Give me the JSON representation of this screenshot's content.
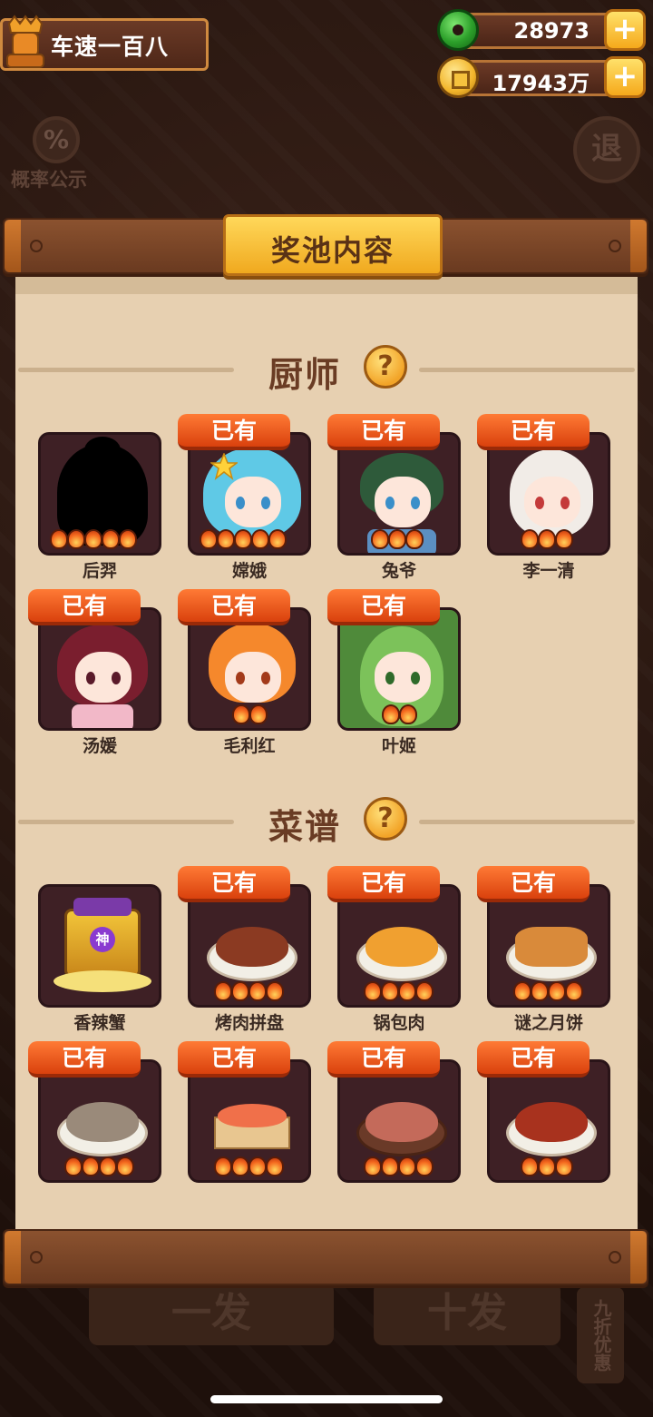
{
  "player": {
    "name": "车速一百八"
  },
  "currency": {
    "jade": "28973",
    "gold": "17943万",
    "plus_label": "+"
  },
  "side": {
    "probability_icon": "%",
    "probability_label": "概率公示",
    "back_label": "退"
  },
  "modal": {
    "title": "奖池内容",
    "chef_section": "厨师",
    "recipe_section": "菜谱",
    "help_label": "?",
    "owned_label": "已有"
  },
  "chefs": [
    {
      "name": "后羿",
      "owned": false,
      "flames": 5
    },
    {
      "name": "嫦娥",
      "owned": true,
      "flames": 5
    },
    {
      "name": "兔爷",
      "owned": true,
      "flames": 3
    },
    {
      "name": "李一清",
      "owned": true,
      "flames": 3
    },
    {
      "name": "汤媛",
      "owned": true,
      "flames": 0
    },
    {
      "name": "毛利红",
      "owned": true,
      "flames": 2
    },
    {
      "name": "叶姬",
      "owned": true,
      "flames": 2
    }
  ],
  "recipes": [
    {
      "name": "香辣蟹",
      "owned": false,
      "flames": 0,
      "badge": "神"
    },
    {
      "name": "烤肉拼盘",
      "owned": true,
      "flames": 4
    },
    {
      "name": "锅包肉",
      "owned": true,
      "flames": 4
    },
    {
      "name": "谜之月饼",
      "owned": true,
      "flames": 4
    },
    {
      "name": "",
      "owned": true,
      "flames": 4
    },
    {
      "name": "",
      "owned": true,
      "flames": 4
    },
    {
      "name": "",
      "owned": true,
      "flames": 4
    },
    {
      "name": "",
      "owned": true,
      "flames": 3
    }
  ],
  "bottom": {
    "single_draw": "一发",
    "ten_draw": "十发",
    "discount": "九折优惠"
  },
  "colors": {
    "owned_badge": "#e2521a",
    "card_bg": "#3e2025",
    "panel_bg": "#e7d0b1",
    "title_tab": "#f7c03a"
  },
  "icons": {
    "jade": "jade-icon",
    "gold": "coin-icon",
    "help": "question-icon",
    "flame": "flame-icon"
  }
}
